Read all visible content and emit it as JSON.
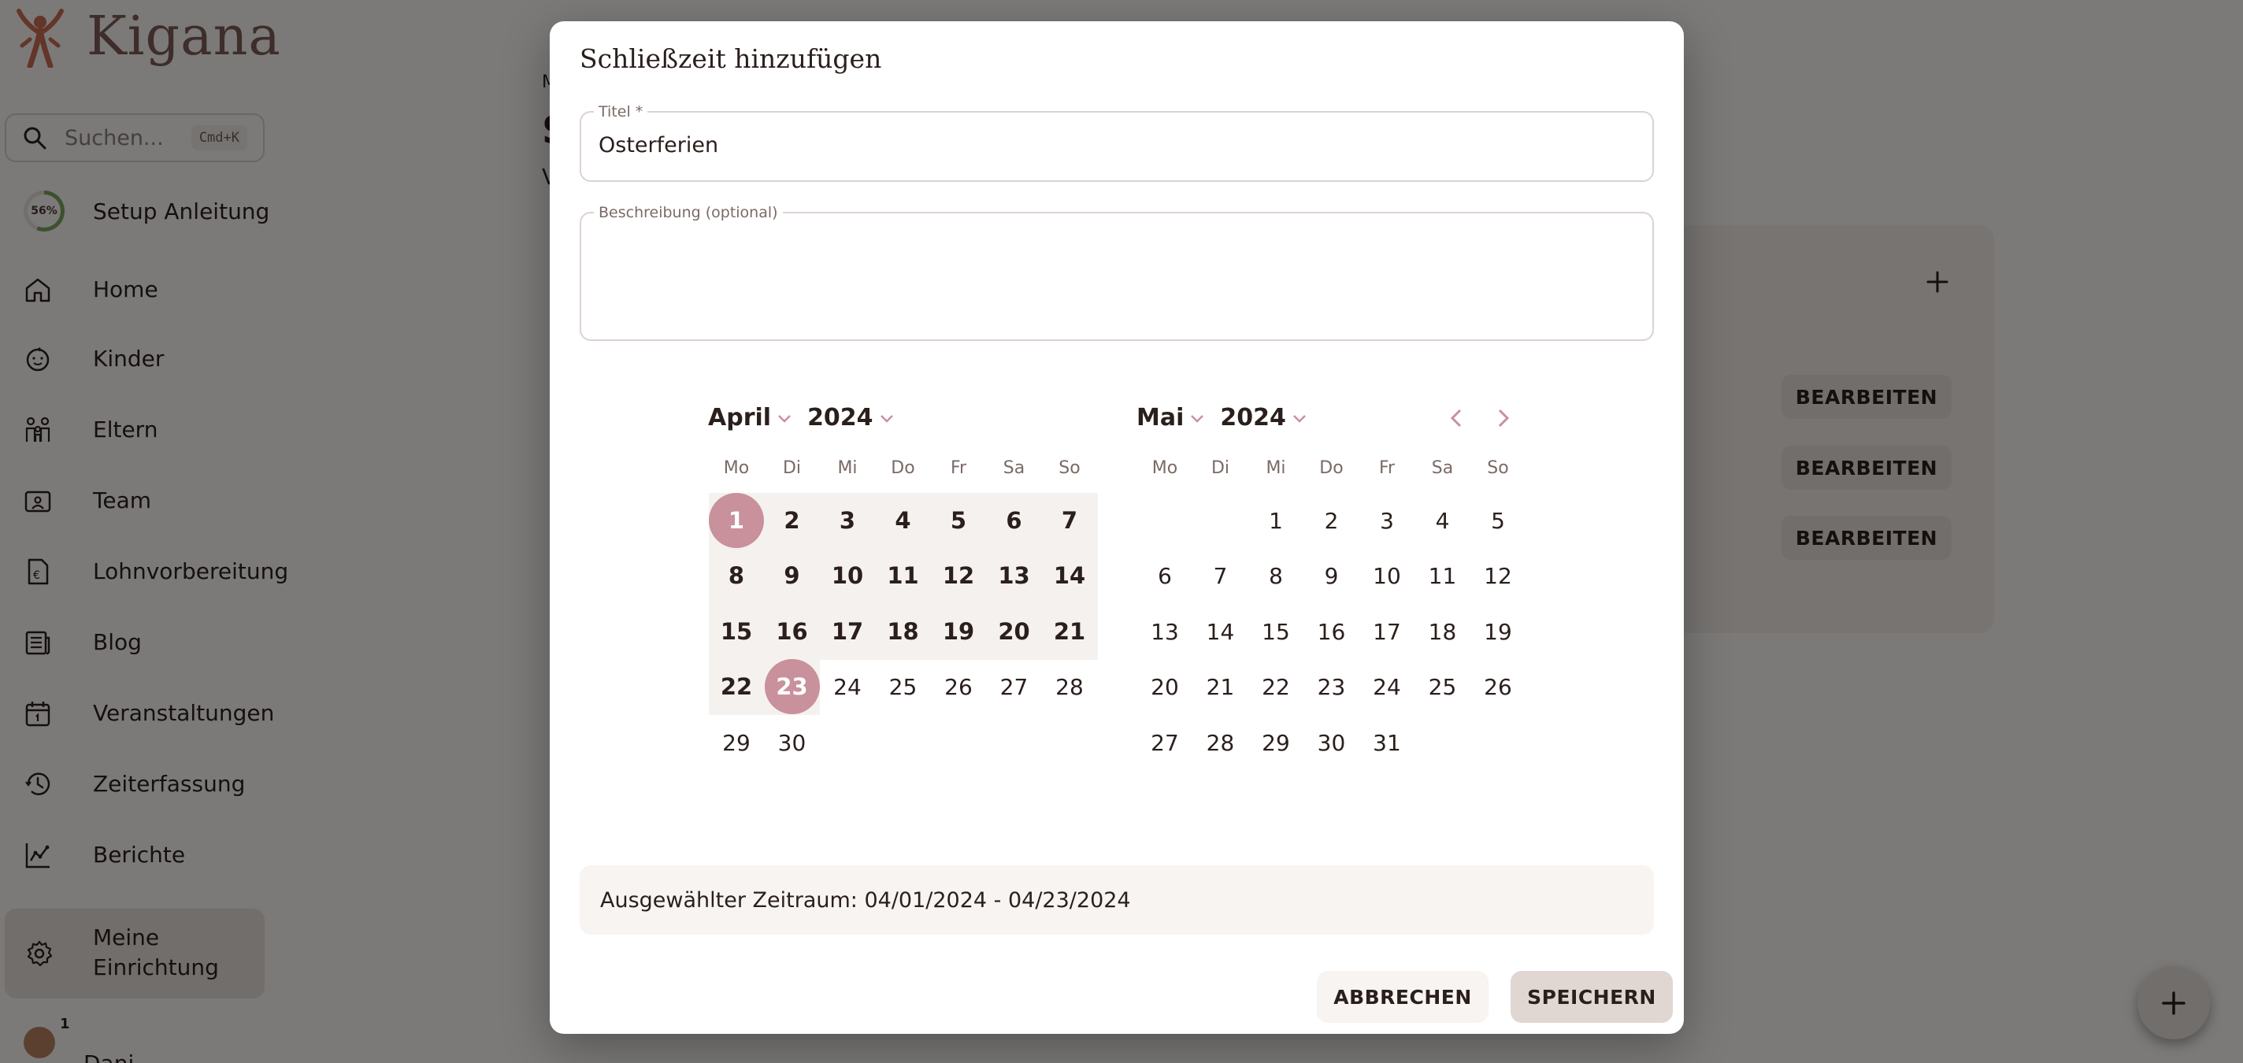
{
  "app": {
    "name": "Kigana",
    "brand_color": "#7c5a56",
    "accent_color": "#c8919c"
  },
  "sidebar": {
    "search": {
      "placeholder": "Suchen...",
      "shortcut": "Cmd+K",
      "icon": "search-icon"
    },
    "setup": {
      "progress_label": "56%",
      "progress": 0.56,
      "label": "Setup Anleitung"
    },
    "items": [
      {
        "label": "Home",
        "icon": "home-icon"
      },
      {
        "label": "Kinder",
        "icon": "child-face-icon"
      },
      {
        "label": "Eltern",
        "icon": "family-icon"
      },
      {
        "label": "Team",
        "icon": "id-card-icon"
      },
      {
        "label": "Lohnvorbereitung",
        "icon": "payroll-document-icon"
      },
      {
        "label": "Blog",
        "icon": "newspaper-icon"
      },
      {
        "label": "Veranstaltungen",
        "icon": "calendar-icon"
      },
      {
        "label": "Zeiterfassung",
        "icon": "clock-history-icon"
      },
      {
        "label": "Berichte",
        "icon": "chart-icon"
      },
      {
        "label": "Meine Einrichtung",
        "icon": "gear-icon",
        "active": true
      }
    ],
    "user": {
      "badge": "1",
      "name": "Dani"
    }
  },
  "main": {
    "heading_initial": "S",
    "subheading_initial": "V",
    "breadcrumb_initial": "M",
    "edit_buttons": [
      "BEARBEITEN",
      "BEARBEITEN",
      "BEARBEITEN"
    ]
  },
  "modal": {
    "title": "Schließzeit hinzufügen",
    "title_field": {
      "label": "Titel *",
      "value": "Osterferien"
    },
    "description_field": {
      "label": "Beschreibung (optional)",
      "value": ""
    },
    "calendar": {
      "weekdays": [
        "Mo",
        "Di",
        "Mi",
        "Do",
        "Fr",
        "Sa",
        "So"
      ],
      "left": {
        "month": "April",
        "year": "2024"
      },
      "right": {
        "month": "Mai",
        "year": "2024"
      },
      "range_start": 1,
      "range_end": 23
    },
    "summary": "Ausgewählter Zeitraum: 04/01/2024 - 04/23/2024",
    "cancel_label": "ABBRECHEN",
    "save_label": "SPEICHERN"
  }
}
